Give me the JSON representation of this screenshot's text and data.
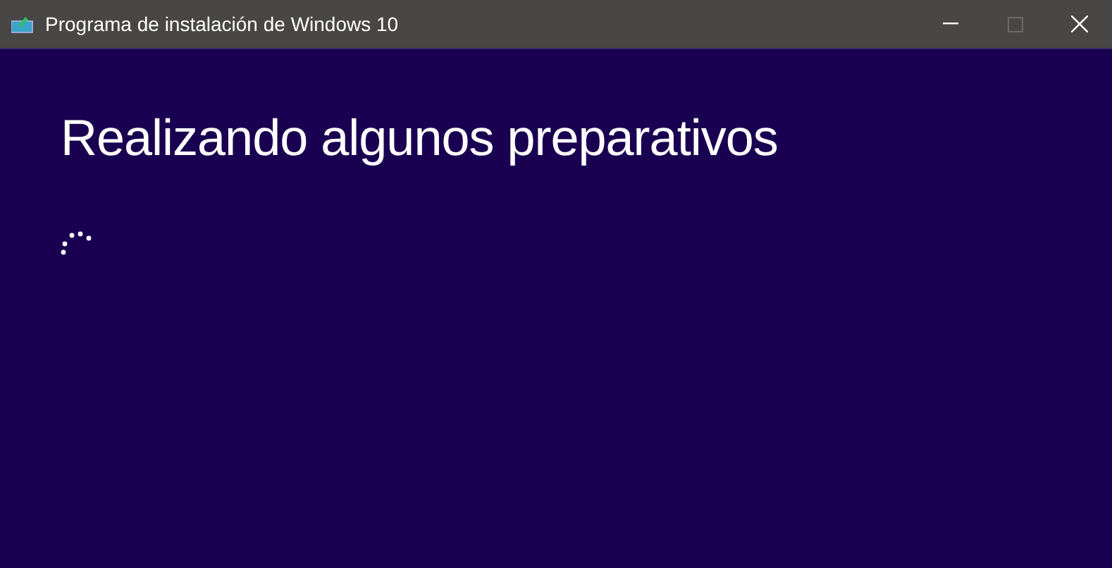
{
  "window": {
    "title": "Programa de instalación de Windows 10"
  },
  "window_buttons": [
    {
      "kind": "minimize",
      "disabled": false
    },
    {
      "kind": "maximize",
      "disabled": true
    },
    {
      "kind": "close",
      "disabled": false
    }
  ],
  "heading": "Realizando algunos preparativos"
}
